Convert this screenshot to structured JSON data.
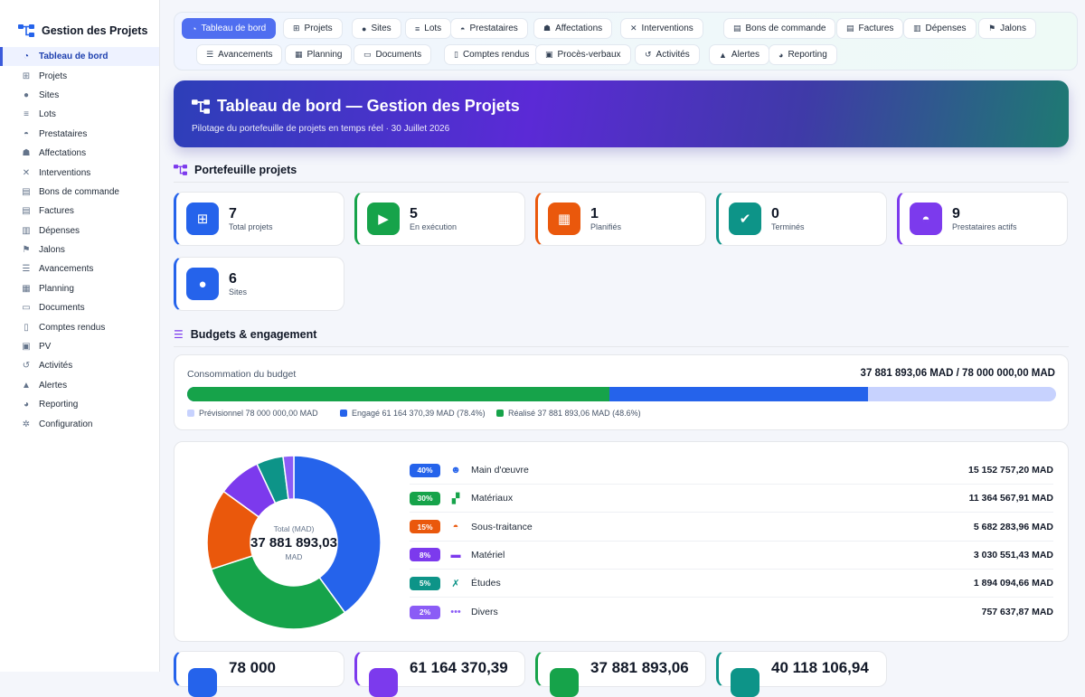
{
  "brand": {
    "title": "Gestion des Projets"
  },
  "sidebar": {
    "items": [
      {
        "label": "Tableau de bord",
        "icon": "dashboard-icon"
      },
      {
        "label": "Projets",
        "icon": "sitemap-icon"
      },
      {
        "label": "Sites",
        "icon": "map-pin-icon"
      },
      {
        "label": "Lots",
        "icon": "layers-icon"
      },
      {
        "label": "Prestataires",
        "icon": "hard-hat-icon"
      },
      {
        "label": "Affectations",
        "icon": "user-tag-icon"
      },
      {
        "label": "Interventions",
        "icon": "tools-icon"
      },
      {
        "label": "Bons de commande",
        "icon": "file-invoice-icon"
      },
      {
        "label": "Factures",
        "icon": "invoice-icon"
      },
      {
        "label": "Dépenses",
        "icon": "money-bill-icon"
      },
      {
        "label": "Jalons",
        "icon": "flag-icon"
      },
      {
        "label": "Avancements",
        "icon": "list-check-icon"
      },
      {
        "label": "Planning",
        "icon": "calendar-icon"
      },
      {
        "label": "Documents",
        "icon": "folder-icon"
      },
      {
        "label": "Comptes rendus",
        "icon": "clipboard-icon"
      },
      {
        "label": "PV",
        "icon": "clipboard-check-icon"
      },
      {
        "label": "Activités",
        "icon": "history-icon"
      },
      {
        "label": "Alertes",
        "icon": "bell-icon"
      },
      {
        "label": "Reporting",
        "icon": "chart-pie-icon"
      },
      {
        "label": "Configuration",
        "icon": "gear-icon"
      }
    ]
  },
  "tabs": [
    {
      "label": "Tableau de bord"
    },
    {
      "label": "Projets"
    },
    {
      "label": "Sites"
    },
    {
      "label": "Lots"
    },
    {
      "label": "Prestataires"
    },
    {
      "label": "Affectations"
    },
    {
      "label": "Interventions"
    },
    {
      "label": "Bons de commande"
    },
    {
      "label": "Factures"
    },
    {
      "label": "Dépenses"
    },
    {
      "label": "Jalons"
    },
    {
      "label": "Avancements"
    },
    {
      "label": "Planning"
    },
    {
      "label": "Documents"
    },
    {
      "label": "Comptes rendus"
    },
    {
      "label": "Procès-verbaux"
    },
    {
      "label": "Activités"
    },
    {
      "label": "Alertes"
    },
    {
      "label": "Reporting"
    }
  ],
  "hero": {
    "title": "Tableau de bord — Gestion des Projets",
    "subtitle": "Pilotage du portefeuille de projets en temps réel · 30 Juillet 2026"
  },
  "portfolio": {
    "title": "Portefeuille projets",
    "kpis": [
      {
        "value": "7",
        "label": "Total projets",
        "color": "#2563eb"
      },
      {
        "value": "5",
        "label": "En exécution",
        "color": "#16a34a"
      },
      {
        "value": "1",
        "label": "Planifiés",
        "color": "#ea580c"
      },
      {
        "value": "0",
        "label": "Terminés",
        "color": "#0d9488"
      },
      {
        "value": "9",
        "label": "Prestataires actifs",
        "color": "#7c3aed"
      },
      {
        "value": "6",
        "label": "Sites",
        "color": "#2563eb"
      }
    ]
  },
  "budget": {
    "title": "Budgets & engagement",
    "label": "Consommation du budget",
    "summary": "37 881 893,06 MAD / 78 000 000,00 MAD",
    "engaged_pct": 78.4,
    "realized_pct": 48.6,
    "legend": [
      {
        "text": "Prévisionnel 78 000 000,00 MAD",
        "color": "#c7d2fe"
      },
      {
        "text": "Engagé 61 164 370,39 MAD (78.4%)",
        "color": "#2563eb"
      },
      {
        "text": "Réalisé 37 881 893,06 MAD (48.6%)",
        "color": "#16a34a"
      }
    ]
  },
  "donut": {
    "center_label": "Total (MAD)",
    "center_value": "37 881 893,03",
    "center_unit": "MAD",
    "segments": [
      {
        "pct": "40%",
        "value": 40,
        "name": "Main d'œuvre",
        "amount": "15 152 757,20 MAD",
        "color": "#2563eb",
        "icon": "users-icon"
      },
      {
        "pct": "30%",
        "value": 30,
        "name": "Matériaux",
        "amount": "11 364 567,91 MAD",
        "color": "#16a34a",
        "icon": "cubes-icon"
      },
      {
        "pct": "15%",
        "value": 15,
        "name": "Sous-traitance",
        "amount": "5 682 283,96 MAD",
        "color": "#ea580c",
        "icon": "hard-hat-icon"
      },
      {
        "pct": "8%",
        "value": 8,
        "name": "Matériel",
        "amount": "3 030 551,43 MAD",
        "color": "#7c3aed",
        "icon": "truck-icon"
      },
      {
        "pct": "5%",
        "value": 5,
        "name": "Études",
        "amount": "1 894 094,66 MAD",
        "color": "#0d9488",
        "icon": "ruler-icon"
      },
      {
        "pct": "2%",
        "value": 2,
        "name": "Divers",
        "amount": "757 637,87 MAD",
        "color": "#8b5cf6",
        "icon": "ellipsis-icon"
      }
    ]
  },
  "bottom_kpis": [
    {
      "value": "78 000",
      "color": "#2563eb"
    },
    {
      "value": "61 164 370,39",
      "color": "#7c3aed"
    },
    {
      "value": "37 881 893,06",
      "color": "#16a34a"
    },
    {
      "value": "40 118 106,94",
      "color": "#0d9488"
    }
  ]
}
